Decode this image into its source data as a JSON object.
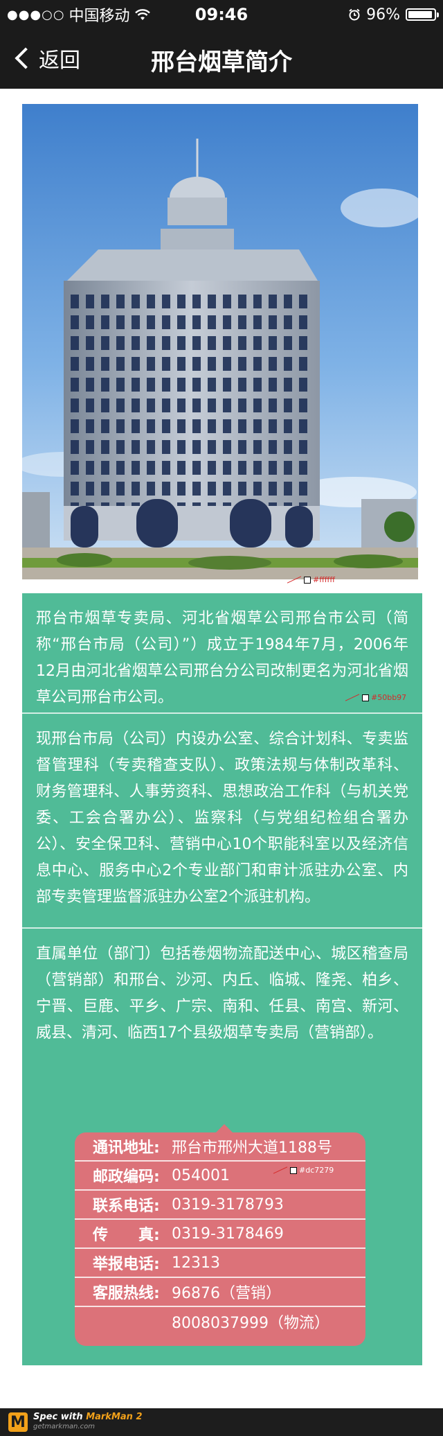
{
  "status_bar": {
    "signal_dots": "●●●○○",
    "carrier": "中国移动",
    "wifi_icon": "wifi-icon",
    "time": "09:46",
    "alarm_icon": "alarm-clock-icon",
    "battery_percent": "96%",
    "battery_level": 0.96
  },
  "nav": {
    "back_label": "返回",
    "title": "邢台烟草简介"
  },
  "spec_annotations": {
    "image_color": "#ffffff",
    "content_bg_color": "#50bb97",
    "card_bg_color": "#dc7279"
  },
  "paragraphs": [
    "邢台市烟草专卖局、河北省烟草公司邢台市公司（简称“邢台市局（公司）”）成立于1984年7月，2006年12月由河北省烟草公司邢台分公司改制更名为河北省烟草公司邢台市公司。",
    "现邢台市局（公司）内设办公室、综合计划科、专卖监督管理科（专卖稽查支队）、政策法规与体制改革科、财务管理科、人事劳资科、思想政治工作科（与机关党委、工会合署办公）、监察科（与党组纪检组合署办公）、安全保卫科、营销中心10个职能科室以及经济信息中心、服务中心2个专业部门和审计派驻办公室、内部专卖管理监督派驻办公室2个派驻机构。",
    "直属单位（部门）包括卷烟物流配送中心、城区稽查局（营销部）和邢台、沙河、内丘、临城、隆尧、柏乡、宁晋、巨鹿、平乡、广宗、南和、任县、南宫、新河、威县、清河、临西17个县级烟草专卖局（营销部）。"
  ],
  "contact": {
    "rows": [
      {
        "label": "通讯地址:",
        "value": "邢台市邢州大道1188号"
      },
      {
        "label": "邮政编码:",
        "value": "054001"
      },
      {
        "label": "联系电话:",
        "value": "0319-3178793"
      },
      {
        "label": "传　　真:",
        "value": "0319-3178469"
      },
      {
        "label": "举报电话:",
        "value": "12313"
      },
      {
        "label": "客服热线:",
        "value": "96876（营销）"
      },
      {
        "label": "",
        "value": "8008037999（物流）"
      }
    ]
  },
  "footer": {
    "spec_prefix": "Spec with ",
    "brand": "MarkMan 2",
    "site": "getmarkman.com",
    "logo_letter": "M"
  },
  "colors": {
    "bar_bg": "#1b1b1b",
    "content_bg": "#50bb97",
    "card_bg": "#dc7279"
  }
}
